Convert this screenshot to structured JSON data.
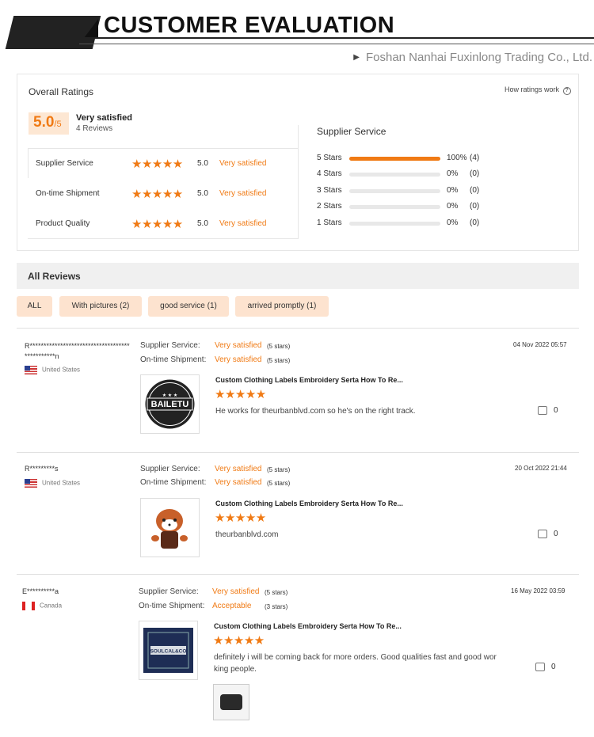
{
  "header": {
    "title": "CUSTOMER EVALUATION",
    "company": "Foshan Nanhai Fuxinlong Trading Co., Ltd."
  },
  "ratings": {
    "title": "Overall Ratings",
    "how_link": "How ratings work",
    "score": "5.0",
    "score_suffix": "/5",
    "summary": "Very satisfied",
    "reviews_count": "4 Reviews",
    "categories": [
      {
        "label": "Supplier Service",
        "score": "5.0",
        "text": "Very satisfied"
      },
      {
        "label": "On-time Shipment",
        "score": "5.0",
        "text": "Very satisfied"
      },
      {
        "label": "Product Quality",
        "score": "5.0",
        "text": "Very satisfied"
      }
    ],
    "supplier_service": {
      "title": "Supplier Service",
      "bars": [
        {
          "label": "5 Stars",
          "pct": "100%",
          "count": "(4)",
          "fill": 1.0
        },
        {
          "label": "4 Stars",
          "pct": "0%",
          "count": "(0)",
          "fill": 0
        },
        {
          "label": "3 Stars",
          "pct": "0%",
          "count": "(0)",
          "fill": 0
        },
        {
          "label": "2 Stars",
          "pct": "0%",
          "count": "(0)",
          "fill": 0
        },
        {
          "label": "1 Stars",
          "pct": "0%",
          "count": "(0)",
          "fill": 0
        }
      ]
    }
  },
  "reviews_section": {
    "title": "All Reviews",
    "filters": [
      "ALL",
      "With pictures (2)",
      "good service (1)",
      "arrived promptly (1)"
    ]
  },
  "reviews": [
    {
      "name_line1": "R************************************",
      "name_line2": "***********n",
      "country": "United States",
      "fields": [
        {
          "label": "Supplier Service:",
          "value": "Very satisfied",
          "stars": "(5 stars)"
        },
        {
          "label": "On-time Shipment:",
          "value": "Very satisfied",
          "stars": "(5 stars)"
        }
      ],
      "date": "04 Nov 2022 05:57",
      "product": "Custom Clothing Labels Embroidery Serta How To Re...",
      "text": "He works for theurbanblvd.com so he's on the right track.",
      "likes": "0",
      "image_text": "BAILETU"
    },
    {
      "name_line1": "R*********s",
      "name_line2": "",
      "country": "United States",
      "fields": [
        {
          "label": "Supplier Service:",
          "value": "Very satisfied",
          "stars": "(5 stars)"
        },
        {
          "label": "On-time Shipment:",
          "value": "Very satisfied",
          "stars": "(5 stars)"
        }
      ],
      "date": "20 Oct 2022 21:44",
      "product": "Custom Clothing Labels Embroidery Serta How To Re...",
      "text": "theurbanblvd.com",
      "likes": "0",
      "image_text": ""
    },
    {
      "name_line1": "E**********a",
      "name_line2": "",
      "country": "Canada",
      "fields": [
        {
          "label": "Supplier Service:",
          "value": "Very satisfied",
          "stars": "(5 stars)"
        },
        {
          "label": "On-time Shipment:",
          "value": "Acceptable",
          "stars": "(3 stars)"
        }
      ],
      "date": "16 May 2022 03:59",
      "product": "Custom Clothing Labels Embroidery Serta How To Re...",
      "text": "definitely i will be coming back for more orders. Good qualities fast and good wor king people.",
      "likes": "0",
      "image_text": "SOULCAL&CO"
    }
  ],
  "colors": {
    "accent": "#f07a14",
    "chip_bg": "#fde3cf",
    "score_bg": "#fde7d3"
  },
  "icons": [
    "play-triangle-icon",
    "question-icon",
    "star-icon",
    "us-flag-icon",
    "ca-flag-icon",
    "thumbs-up-icon"
  ]
}
